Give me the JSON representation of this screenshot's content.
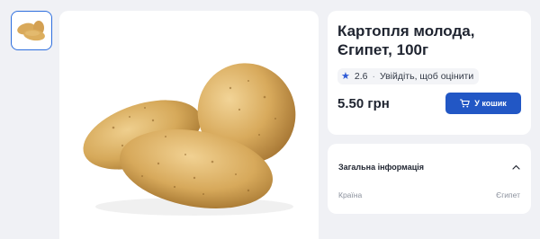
{
  "product": {
    "title": "Картопля молода, Єгипет, 100г",
    "rating_value": "2.6",
    "rating_separator": "·",
    "rating_prompt": "Увійдіть, щоб оцінити",
    "price": "5.50 грн",
    "add_to_cart_label": "У кошик"
  },
  "general_info": {
    "title": "Загальна інформація",
    "rows": [
      {
        "label": "Країна",
        "value": "Єгипет"
      }
    ]
  },
  "icons": {
    "star": "star-icon",
    "cart": "cart-icon",
    "chevron": "chevron-up-icon"
  },
  "colors": {
    "accent": "#2257c5",
    "page_bg": "#f0f1f5",
    "thumb_border": "#2e6fde"
  }
}
